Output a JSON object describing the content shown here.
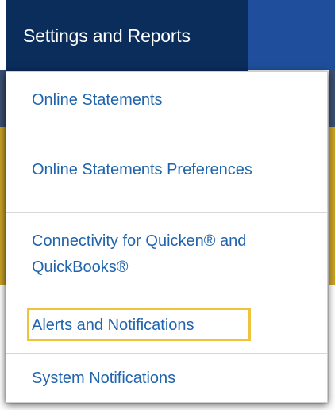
{
  "menu": {
    "header_label": "Settings and Reports",
    "items": [
      {
        "label": "Online Statements"
      },
      {
        "label": "Online Statements Preferences"
      },
      {
        "label": "Connectivity for Quicken® and QuickBooks®"
      },
      {
        "label": "Alerts and Notifications",
        "highlighted": true
      },
      {
        "label": "System Notifications"
      }
    ]
  },
  "colors": {
    "header_bg": "#0b2d5c",
    "link": "#1f64ad",
    "highlight": "#f0c33c"
  }
}
